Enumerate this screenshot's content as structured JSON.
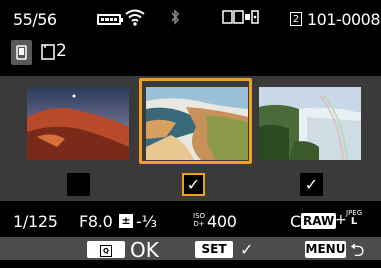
{
  "status": {
    "counter": "55/56",
    "card_slot_number": "2",
    "file_number": "101-0008",
    "icons": [
      "battery-icon",
      "wifi-icon",
      "bluetooth-icon",
      "card-mode-icon"
    ]
  },
  "display_mode": {
    "camera_tab_icon": "camera-icon",
    "card_tab_label": "2"
  },
  "thumbnails": [
    {
      "name": "thumbnail-sunset-rock",
      "checked": false,
      "selected": false
    },
    {
      "name": "thumbnail-coast-beach",
      "checked": true,
      "selected": true
    },
    {
      "name": "thumbnail-waterfall",
      "checked": true,
      "selected": false
    }
  ],
  "checkmark": "✓",
  "shooting_info": {
    "shutter": "1/125",
    "aperture": "F8.0",
    "ev_icon": "±",
    "exposure_comp": "-⅓",
    "iso_label_top": "ISO",
    "iso_label_bottom": "D+",
    "iso_value": "400",
    "quality_prefix": "C",
    "raw_label": "RAW",
    "plus": "+",
    "jpeg_label": "JPEG",
    "jpeg_size": "L"
  },
  "buttons": {
    "q_key": "Q",
    "ok_label": "OK",
    "set_label": "SET",
    "set_action": "✓",
    "menu_label": "MENU",
    "back_icon": "⮌"
  },
  "colors": {
    "selection": "#f0a020",
    "panel": "#3a3a3a"
  }
}
